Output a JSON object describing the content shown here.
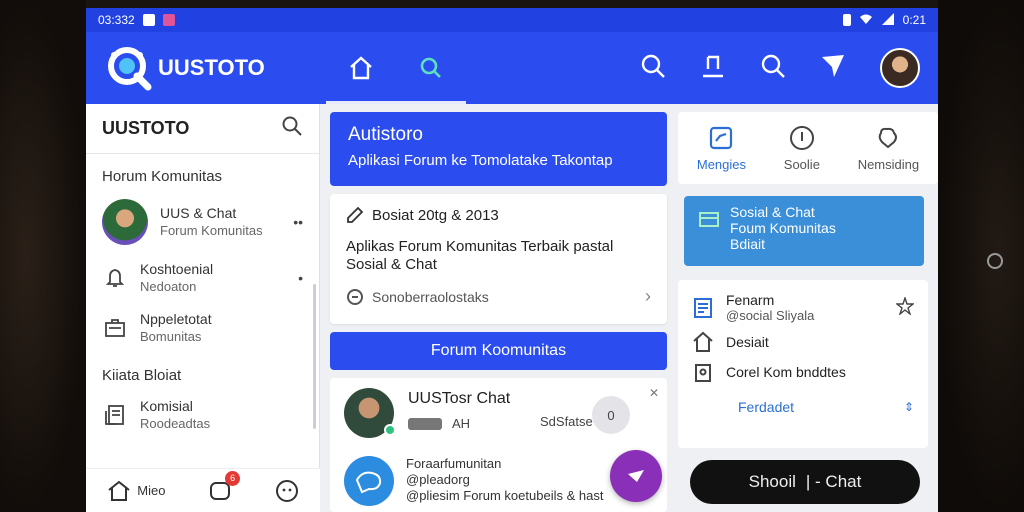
{
  "statusbar": {
    "time_left": "03:332",
    "time_right": "0:21"
  },
  "app": {
    "logo_text": "UUSTOTO"
  },
  "sidebar": {
    "title": "UUSTOTO",
    "section1": "Horum Komunitas",
    "items": [
      {
        "title": "UUS & Chat",
        "sub": "Forum Komunitas",
        "more": "••"
      },
      {
        "title": "Koshtoenial",
        "sub": "Nedoaton",
        "more": "•"
      },
      {
        "title": "Nppeletotat",
        "sub": "Bomunitas"
      }
    ],
    "section2": "Kiiata Bloiat",
    "items2": [
      {
        "title": "Komisial",
        "sub": "Roodeadtas"
      }
    ],
    "bottom": {
      "label": "Mieo",
      "badge": "6"
    }
  },
  "main": {
    "banner_title": "Autistoro",
    "banner_sub": "Aplikasi Forum ke Tomolatake Takontap",
    "post_header": "Bosiat 20tg & 2013",
    "post_text": "Aplikas Forum Komunitas Terbaik pastal Sosial & Chat",
    "post_footer": "Sonoberraolostaks",
    "forum_button": "Forum Koomunitas",
    "chat_title": "UUSTosr Chat",
    "chat_meta": "AH",
    "chat_side": "SdSfatse",
    "chat_round": "0",
    "chat2_title": "Foraarfumunitan",
    "chat2_sub1": "@pleadorg",
    "chat2_sub2": "@pliesim Forum koetubeils & hast"
  },
  "right": {
    "quick": [
      {
        "label": "Mengies"
      },
      {
        "label": "Soolie"
      },
      {
        "label": "Nemsiding"
      }
    ],
    "info_title": "Sosial & Chat",
    "info_sub1": "Foum Komunitas",
    "info_sub2": "Bdiait",
    "list": [
      {
        "title": "Fenarm",
        "sub": "@social Sliyala"
      },
      {
        "title": "Desiait"
      },
      {
        "title": "Corel Kom bnddtes"
      }
    ],
    "link": "Ferdadet",
    "chat_button_left": "Shooil",
    "chat_button_right": "| - Chat"
  },
  "colors": {
    "primary": "#2b4df0",
    "info": "#3a8fd8",
    "fab": "#8a2fb8"
  }
}
